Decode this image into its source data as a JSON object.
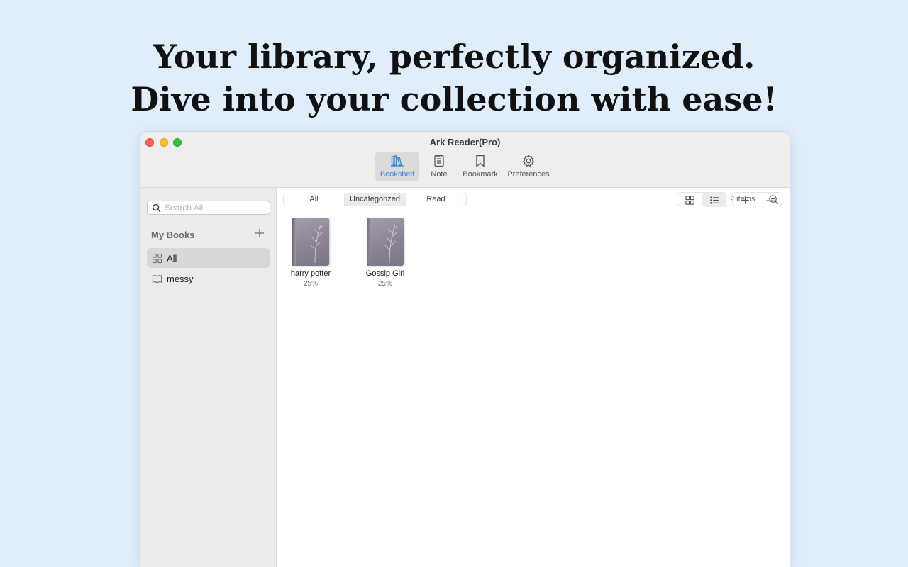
{
  "headline": {
    "line1": "Your library, perfectly organized.",
    "line2": "Dive into your collection with ease!"
  },
  "window": {
    "title": "Ark Reader(Pro)"
  },
  "toolbar": {
    "bookshelf": "Bookshelf",
    "note": "Note",
    "bookmark": "Bookmark",
    "preferences": "Preferences",
    "active": "bookshelf",
    "accent_color": "#3a8bd6"
  },
  "sidebar": {
    "search_placeholder": "Search All",
    "section_title": "My Books",
    "items": [
      {
        "label": "All",
        "icon": "grid-icon",
        "selected": true
      },
      {
        "label": "messy",
        "icon": "book-open-icon",
        "selected": false
      }
    ]
  },
  "main": {
    "filters": [
      {
        "label": "All",
        "selected": false
      },
      {
        "label": "Uncategorized",
        "selected": true
      },
      {
        "label": "Read",
        "selected": false
      }
    ],
    "item_count": "2 items",
    "view_mode": "list",
    "books": [
      {
        "title": "harry potter",
        "progress": "25%"
      },
      {
        "title": "Gossip Girl",
        "progress": "25%"
      }
    ]
  }
}
